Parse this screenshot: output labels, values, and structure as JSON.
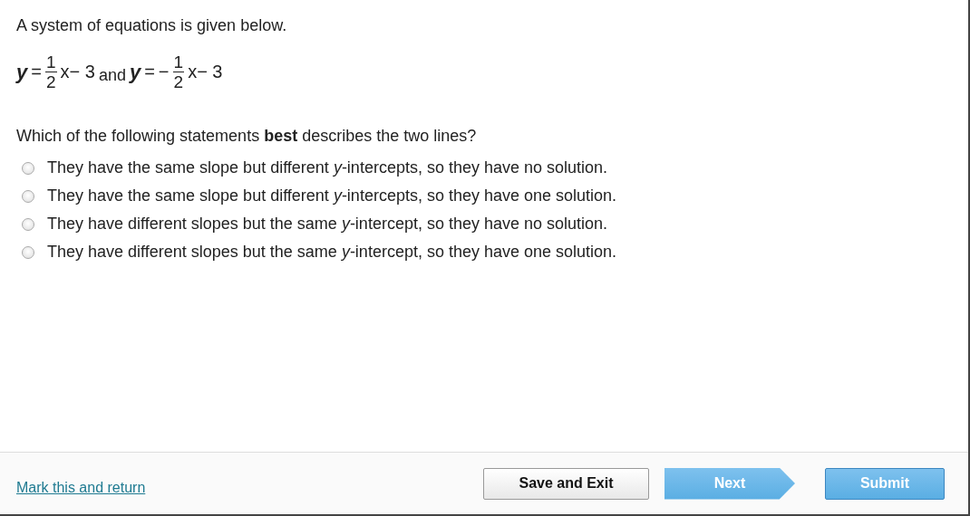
{
  "prompt": "A system of equations is given below.",
  "equations": [
    {
      "variable": "y",
      "equals": "=",
      "numerator": "1",
      "denominator": "2",
      "tail": "x− 3"
    },
    {
      "variable": "y",
      "equals": "=",
      "sign": "−",
      "numerator": "1",
      "denominator": "2",
      "tail": "x− 3"
    }
  ],
  "connector": "and",
  "question": "Which of the following statements **best** describes the two lines?",
  "options": [
    {
      "text": "They have the same slope but different *y*-intercepts, so they have no solution.",
      "selected": false
    },
    {
      "text": "They have the same slope but different *y*-intercepts, so they have one solution.",
      "selected": false
    },
    {
      "text": "They have different slopes but the same *y*-intercept, so they have no solution.",
      "selected": false
    },
    {
      "text": "They have different slopes but the same *y*-intercept, so they have one solution.",
      "selected": false
    }
  ],
  "footer": {
    "link": "Mark this and return",
    "save_button": "Save and Exit",
    "next_button": "Next",
    "submit_button": "Submit"
  }
}
